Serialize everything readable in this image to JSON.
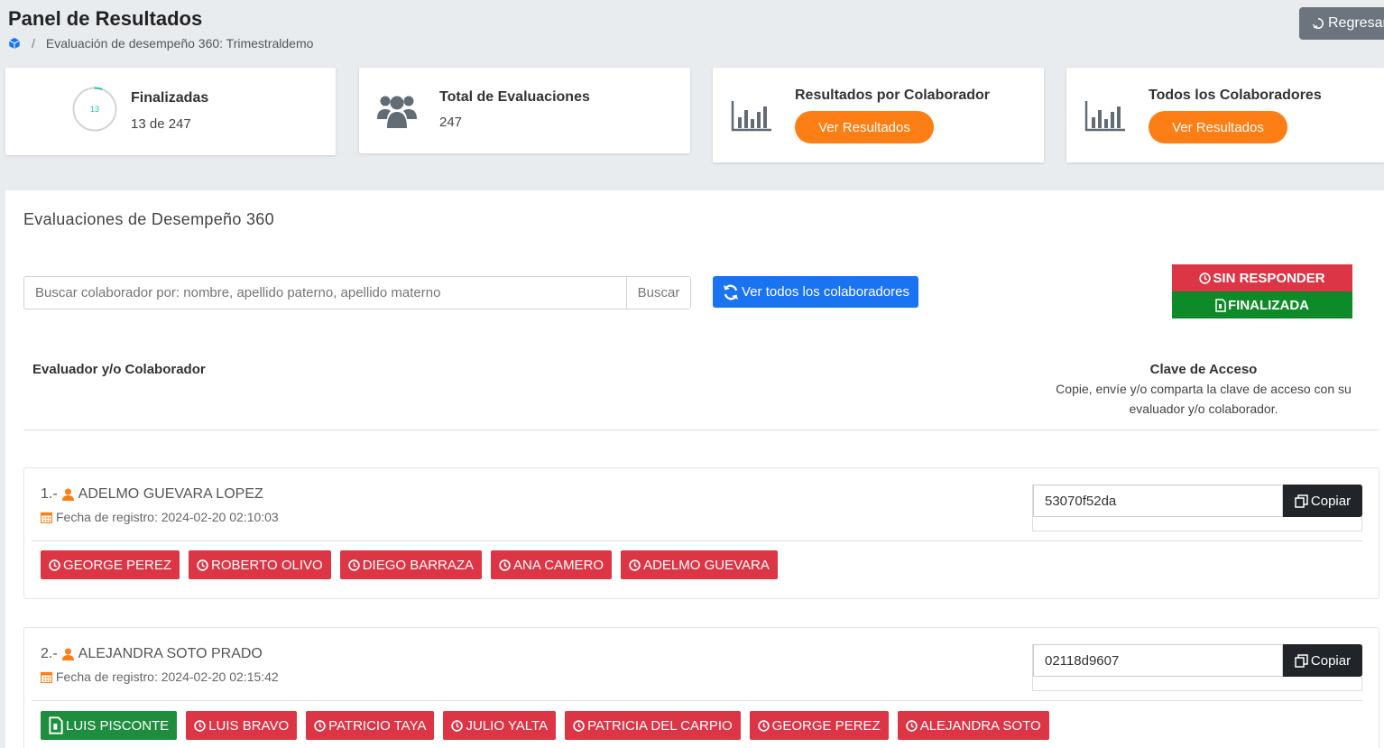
{
  "header": {
    "title": "Panel de Resultados",
    "breadcrumb_current": "Evaluación de desempeño 360: Trimestraldemo",
    "back_label": "Regresar"
  },
  "stats": {
    "finalizadas": {
      "title": "Finalizadas",
      "value": "13 de 247",
      "ring_value": "13",
      "progress": 0.0526
    },
    "total": {
      "title": "Total de Evaluaciones",
      "value": "247"
    },
    "por_colaborador": {
      "title": "Resultados por Colaborador",
      "button": "Ver Resultados"
    },
    "todos": {
      "title": "Todos los Colaboradores",
      "button": "Ver Resultados"
    }
  },
  "main": {
    "section_title": "Evaluaciones de Desempeño 360",
    "search_placeholder": "Buscar colaborador por: nombre, apellido paterno, apellido materno",
    "search_button": "Buscar",
    "view_all_button": "Ver todos los colaboradores",
    "legend": {
      "pending": "SIN RESPONDER",
      "done": "FINALIZADA"
    },
    "table": {
      "col_left": "Evaluador y/o Colaborador",
      "col_right_title": "Clave de Acceso",
      "col_right_desc": "Copie, envíe y/o comparta la clave de acceso con su evaluador y/o colaborador."
    },
    "copy_label": "Copiar",
    "rows": [
      {
        "index": "1.-",
        "name": "ADELMO GUEVARA LOPEZ",
        "date": "Fecha de registro: 2024-02-20 02:10:03",
        "key": "53070f52da",
        "evaluators": [
          {
            "name": "GEORGE PEREZ",
            "status": "pending"
          },
          {
            "name": "ROBERTO OLIVO",
            "status": "pending"
          },
          {
            "name": "DIEGO BARRAZA",
            "status": "pending"
          },
          {
            "name": "ANA CAMERO",
            "status": "pending"
          },
          {
            "name": "ADELMO GUEVARA",
            "status": "pending"
          }
        ]
      },
      {
        "index": "2.-",
        "name": "ALEJANDRA SOTO PRADO",
        "date": "Fecha de registro: 2024-02-20 02:15:42",
        "key": "02118d9607",
        "evaluators": [
          {
            "name": "LUIS PISCONTE",
            "status": "done"
          },
          {
            "name": "LUIS BRAVO",
            "status": "pending"
          },
          {
            "name": "PATRICIO TAYA",
            "status": "pending"
          },
          {
            "name": "JULIO YALTA",
            "status": "pending"
          },
          {
            "name": "PATRICIA DEL CARPIO",
            "status": "pending"
          },
          {
            "name": "GEORGE PEREZ",
            "status": "pending"
          },
          {
            "name": "ALEJANDRA SOTO",
            "status": "pending"
          }
        ]
      }
    ]
  },
  "colors": {
    "orange": "#fd7e14",
    "blue": "#1a73f0",
    "red": "#dc3545",
    "green": "#1e8e3e",
    "dark": "#212529",
    "ring": "#20c997"
  }
}
